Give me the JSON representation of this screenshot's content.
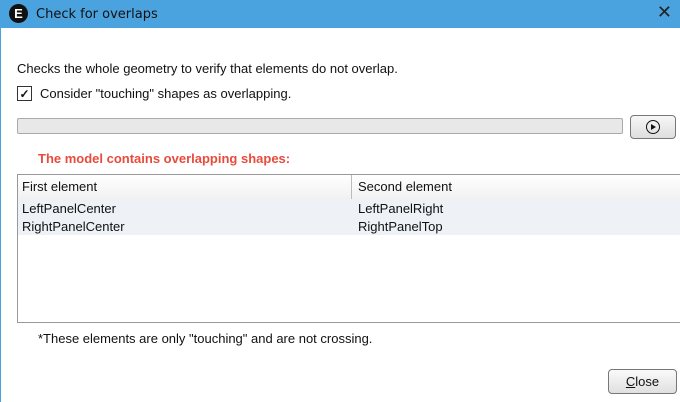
{
  "window": {
    "title": "Check for overlaps",
    "app_icon_letter": "E"
  },
  "content": {
    "description": "Checks the whole geometry to verify that elements do not overlap.",
    "touching_option": {
      "label": "Consider \"touching\" shapes as overlapping.",
      "checked": true
    },
    "progress_fraction": 0,
    "warning": "The model contains overlapping shapes:",
    "table": {
      "columns": [
        "First element",
        "Second element"
      ],
      "rows": [
        [
          "LeftPanelCenter",
          "LeftPanelRight"
        ],
        [
          "RightPanelCenter",
          "RightPanelTop"
        ]
      ]
    },
    "footnote": "*These elements are only \"touching\" and are not crossing.",
    "close_button": {
      "mnemonic": "C",
      "rest": "lose"
    }
  },
  "icons": {
    "app": "e-logo-icon",
    "close": "close-icon",
    "run": "play-icon"
  },
  "colors": {
    "titlebar": "#4aa3df",
    "warning": "#e84b3c",
    "row_background": "#eef1f6"
  }
}
